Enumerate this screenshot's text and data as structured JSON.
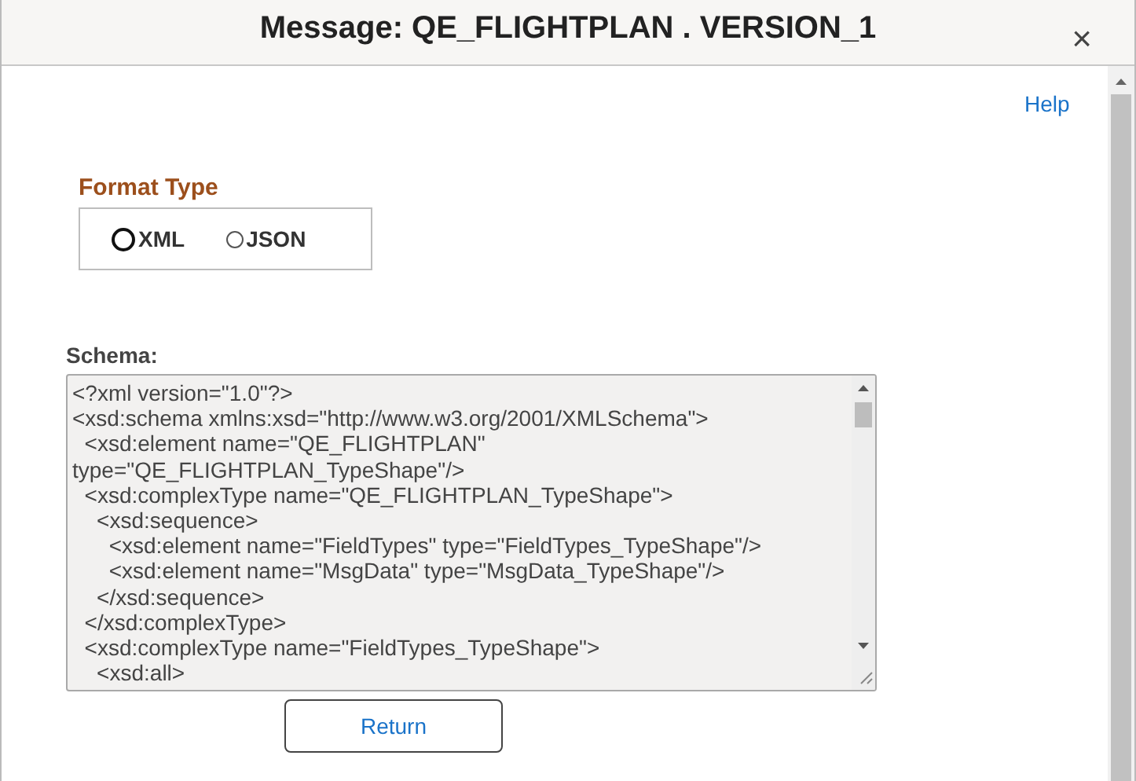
{
  "dialog": {
    "title": "Message: QE_FLIGHTPLAN . VERSION_1",
    "close": "×"
  },
  "help_link": "Help",
  "format_type": {
    "label": "Format Type",
    "options": [
      {
        "label": "XML",
        "selected": false,
        "focused": true
      },
      {
        "label": "JSON",
        "selected": false,
        "focused": false
      }
    ]
  },
  "schema": {
    "label": "Schema:",
    "lines": [
      "<?xml version=\"1.0\"?>",
      "<xsd:schema xmlns:xsd=\"http://www.w3.org/2001/XMLSchema\">",
      "  <xsd:element name=\"QE_FLIGHTPLAN\"",
      "type=\"QE_FLIGHTPLAN_TypeShape\"/>",
      "  <xsd:complexType name=\"QE_FLIGHTPLAN_TypeShape\">",
      "    <xsd:sequence>",
      "      <xsd:element name=\"FieldTypes\" type=\"FieldTypes_TypeShape\"/>",
      "      <xsd:element name=\"MsgData\" type=\"MsgData_TypeShape\"/>",
      "    </xsd:sequence>",
      "  </xsd:complexType>",
      "  <xsd:complexType name=\"FieldTypes_TypeShape\">",
      "    <xsd:all>"
    ]
  },
  "buttons": [
    {
      "label": "Return"
    }
  ]
}
